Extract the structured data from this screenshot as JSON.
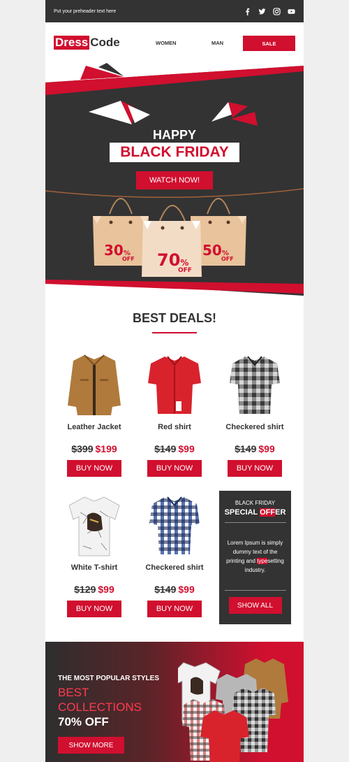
{
  "preheader": {
    "text": "Put your preheader text here"
  },
  "social": [
    "facebook-icon",
    "twitter-icon",
    "instagram-icon",
    "youtube-icon"
  ],
  "header": {
    "logo_part1": "Dress",
    "logo_part2": "Code",
    "nav": {
      "women": "WOMEN",
      "man": "MAN",
      "sale": "SALE"
    }
  },
  "hero": {
    "happy": "HAPPY",
    "black_friday": "BLACK FRIDAY",
    "watch": "WATCH NOW!",
    "bags": [
      {
        "pct": "30",
        "off": "OFF"
      },
      {
        "pct": "70",
        "off": "OFF"
      },
      {
        "pct": "50",
        "off": "OFF"
      }
    ]
  },
  "deals": {
    "title": "BEST DEALS!",
    "products": [
      {
        "name": "Leather Jacket",
        "old": "$399",
        "new": "$199",
        "buy": "BUY NOW"
      },
      {
        "name": "Red shirt",
        "old": "$149",
        "new": "$99",
        "buy": "BUY NOW"
      },
      {
        "name": "Checkered shirt",
        "old": "$149",
        "new": "$99",
        "buy": "BUY NOW"
      },
      {
        "name": "White T-shirt",
        "old": "$129",
        "new": "$99",
        "buy": "BUY NOW"
      },
      {
        "name": "Checkered shirt",
        "old": "$149",
        "new": "$99",
        "buy": "BUY NOW"
      }
    ]
  },
  "special": {
    "line1": "BLACK FRIDAY",
    "line2_a": "SPECIAL ",
    "line2_hl": "OFF",
    "line2_b": "ER",
    "desc_a": "Lorem Ipsum is simply dummy text of the printing and ",
    "desc_hl": "type",
    "desc_b": "setting industry.",
    "show_all": "SHOW ALL"
  },
  "banner": {
    "line1": "THE MOST POPULAR STYLES",
    "line2": "BEST COLLECTIONS",
    "line3": "70% OFF",
    "button": "SHOW MORE"
  },
  "colors": {
    "accent": "#d10f2f",
    "dark": "#333333",
    "page_bg": "#efefef"
  }
}
